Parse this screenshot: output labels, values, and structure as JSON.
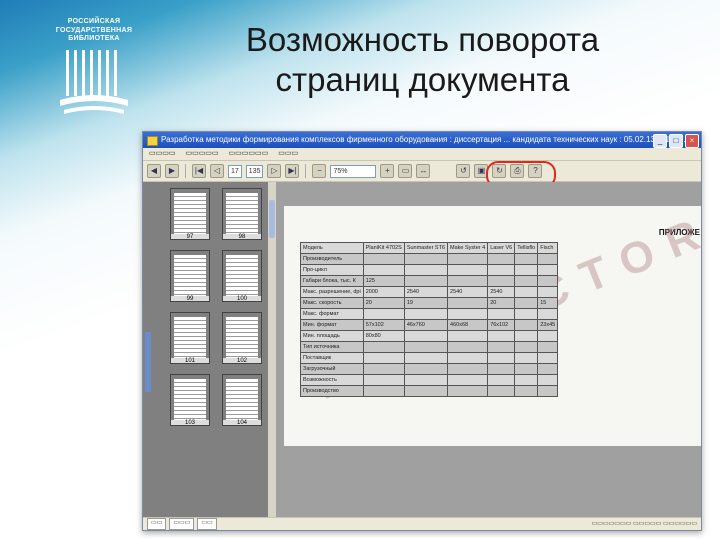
{
  "logo": {
    "lines": [
      "РОССИЙСКАЯ",
      "ГОСУДАРСТВЕННАЯ",
      "БИБЛИОТЕКА"
    ]
  },
  "slide": {
    "title_line1": "Возможность поворота",
    "title_line2": "страниц документа"
  },
  "window": {
    "title": "Разработка методики формирования комплексов фирменного оборудования : диссертация ... кандидата технических наук : 05.02.13 / Шевч...",
    "zoom": "75%",
    "page_field": "17",
    "page_total": "135"
  },
  "thumbnails": [
    "97",
    "98",
    "99",
    "100",
    "101",
    "102",
    "103",
    "104"
  ],
  "document": {
    "heading": "ПРИЛОЖЕ",
    "watermark": "PREDOCTORAT",
    "table_header": [
      "Модель",
      "PlaniKit 4702S",
      "Sunmaster ST6",
      "Make Syster 4",
      "Laser V6",
      "Tellisflo",
      "Fisch"
    ],
    "table_rows": [
      [
        "Производитель",
        "",
        "",
        "",
        "",
        "",
        ""
      ],
      [
        "Про-цикл",
        "",
        "",
        "",
        "",
        "",
        ""
      ],
      [
        "Габари блока, тыс. К",
        "125",
        "",
        "",
        "",
        "",
        ""
      ],
      [
        "Макс. разрешение, dpi",
        "2000",
        "2540",
        "2540",
        "2540",
        "",
        ""
      ],
      [
        "Макс. скорость",
        "20",
        "19",
        "",
        "20",
        "",
        "15"
      ],
      [
        "Макс. формат",
        "",
        "",
        "",
        "",
        "",
        ""
      ],
      [
        "Мин. формат",
        "57x102",
        "46x760",
        "460x68",
        "76x102",
        "",
        "23x45"
      ],
      [
        "Мин. площадь",
        "80x80",
        "",
        "",
        "",
        "",
        ""
      ],
      [
        "Тип источника",
        "",
        "",
        "",
        "",
        "",
        ""
      ],
      [
        "Поставщик",
        "",
        "",
        "",
        "",
        "",
        ""
      ],
      [
        "Загрузочный",
        "",
        "",
        "",
        "",
        "",
        ""
      ],
      [
        "Возможность",
        "",
        "",
        "",
        "",
        "",
        ""
      ],
      [
        "Производство",
        "",
        "",
        "",
        "",
        "",
        ""
      ]
    ]
  }
}
